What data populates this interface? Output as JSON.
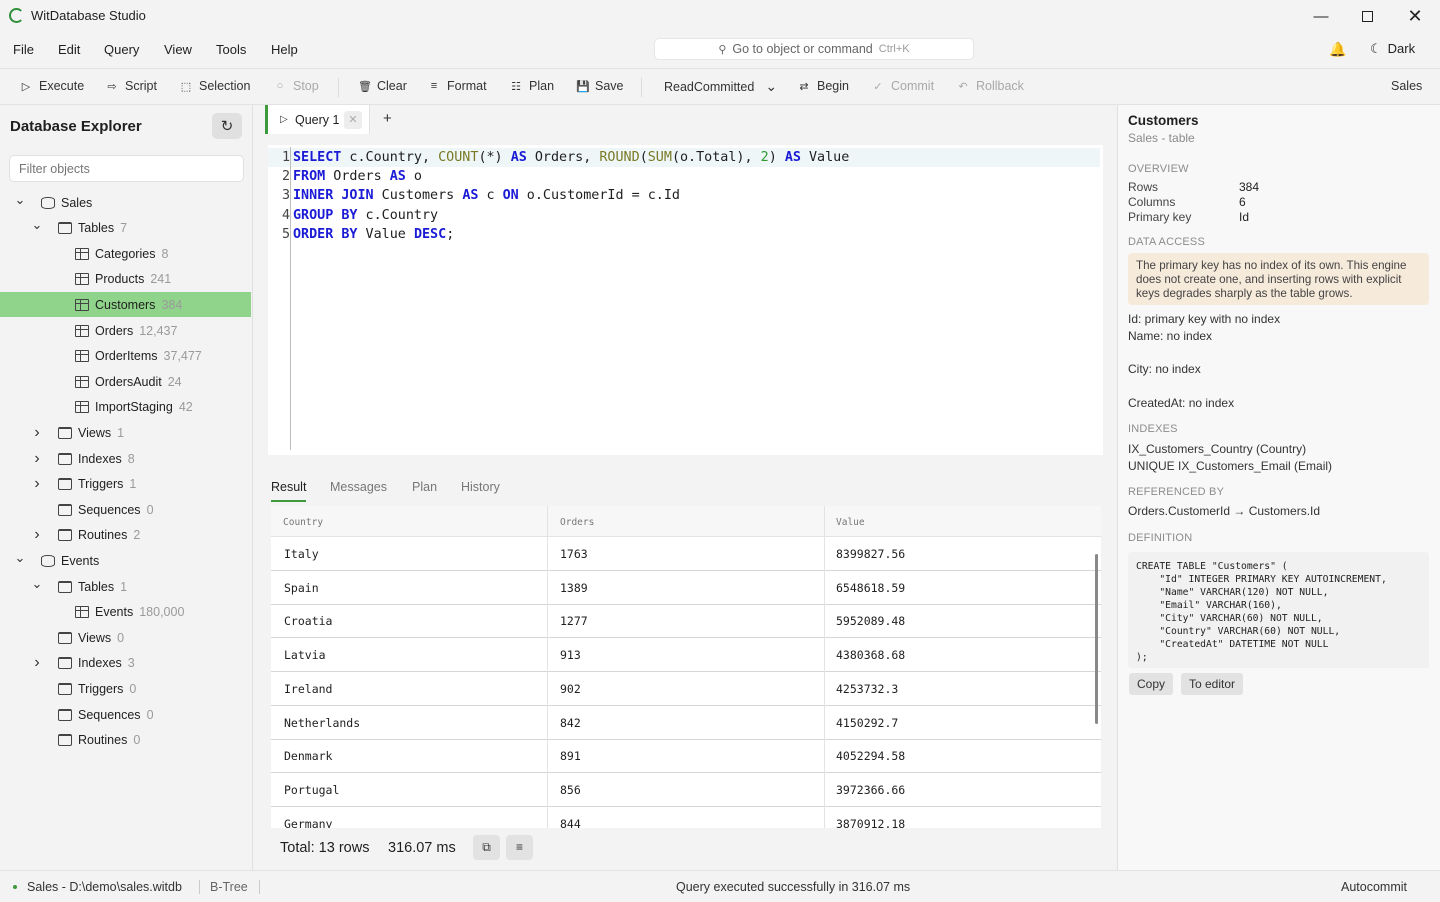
{
  "app": {
    "title": "WitDatabase Studio"
  },
  "menu": [
    "File",
    "Edit",
    "Query",
    "View",
    "Tools",
    "Help"
  ],
  "command_search": {
    "placeholder": "Go to object or command",
    "shortcut": "Ctrl+K"
  },
  "theme_toggle": "Dark",
  "toolbar": {
    "execute": "Execute",
    "script": "Script",
    "selection": "Selection",
    "stop": "Stop",
    "clear": "Clear",
    "format": "Format",
    "plan": "Plan",
    "save": "Save",
    "isolation": "ReadCommitted",
    "begin": "Begin",
    "commit": "Commit",
    "rollback": "Rollback",
    "database": "Sales"
  },
  "explorer": {
    "title": "Database Explorer",
    "filter_placeholder": "Filter objects",
    "tree": [
      {
        "label": "Sales",
        "count": "",
        "level": 0,
        "kind": "db",
        "chev": "open"
      },
      {
        "label": "Tables",
        "count": "7",
        "level": 1,
        "kind": "folder",
        "chev": "open"
      },
      {
        "label": "Categories",
        "count": "8",
        "level": 2,
        "kind": "table",
        "chev": ""
      },
      {
        "label": "Products",
        "count": "241",
        "level": 2,
        "kind": "table",
        "chev": ""
      },
      {
        "label": "Customers",
        "count": "384",
        "level": 2,
        "kind": "table",
        "chev": "",
        "selected": true
      },
      {
        "label": "Orders",
        "count": "12,437",
        "level": 2,
        "kind": "table",
        "chev": ""
      },
      {
        "label": "OrderItems",
        "count": "37,477",
        "level": 2,
        "kind": "table",
        "chev": ""
      },
      {
        "label": "OrdersAudit",
        "count": "24",
        "level": 2,
        "kind": "table",
        "chev": ""
      },
      {
        "label": "ImportStaging",
        "count": "42",
        "level": 2,
        "kind": "table",
        "chev": ""
      },
      {
        "label": "Views",
        "count": "1",
        "level": 1,
        "kind": "folder",
        "chev": "closed"
      },
      {
        "label": "Indexes",
        "count": "8",
        "level": 1,
        "kind": "folder",
        "chev": "closed"
      },
      {
        "label": "Triggers",
        "count": "1",
        "level": 1,
        "kind": "folder",
        "chev": "closed"
      },
      {
        "label": "Sequences",
        "count": "0",
        "level": 1,
        "kind": "folder",
        "chev": ""
      },
      {
        "label": "Routines",
        "count": "2",
        "level": 1,
        "kind": "folder",
        "chev": "closed"
      },
      {
        "label": "Events",
        "count": "",
        "level": 0,
        "kind": "db",
        "chev": "open"
      },
      {
        "label": "Tables",
        "count": "1",
        "level": 1,
        "kind": "folder",
        "chev": "open"
      },
      {
        "label": "Events",
        "count": "180,000",
        "level": 2,
        "kind": "table",
        "chev": ""
      },
      {
        "label": "Views",
        "count": "0",
        "level": 1,
        "kind": "folder",
        "chev": ""
      },
      {
        "label": "Indexes",
        "count": "3",
        "level": 1,
        "kind": "folder",
        "chev": "closed"
      },
      {
        "label": "Triggers",
        "count": "0",
        "level": 1,
        "kind": "folder",
        "chev": ""
      },
      {
        "label": "Sequences",
        "count": "0",
        "level": 1,
        "kind": "folder",
        "chev": ""
      },
      {
        "label": "Routines",
        "count": "0",
        "level": 1,
        "kind": "folder",
        "chev": ""
      }
    ]
  },
  "editor": {
    "tab_label": "Query 1",
    "lines": [
      [
        [
          "kw",
          "SELECT"
        ],
        [
          "tx",
          " c.Country, "
        ],
        [
          "fn",
          "COUNT"
        ],
        [
          "tx",
          "(*) "
        ],
        [
          "kw",
          "AS"
        ],
        [
          "tx",
          " Orders, "
        ],
        [
          "fn",
          "ROUND"
        ],
        [
          "tx",
          "("
        ],
        [
          "fn",
          "SUM"
        ],
        [
          "tx",
          "(o.Total), "
        ],
        [
          "nm",
          "2"
        ],
        [
          "tx",
          ") "
        ],
        [
          "kw",
          "AS"
        ],
        [
          "tx",
          " Value"
        ]
      ],
      [
        [
          "kw",
          "FROM"
        ],
        [
          "tx",
          " Orders "
        ],
        [
          "kw",
          "AS"
        ],
        [
          "tx",
          " o"
        ]
      ],
      [
        [
          "kw",
          "INNER JOIN"
        ],
        [
          "tx",
          " Customers "
        ],
        [
          "kw",
          "AS"
        ],
        [
          "tx",
          " c "
        ],
        [
          "kw",
          "ON"
        ],
        [
          "tx",
          " o.CustomerId = c.Id"
        ]
      ],
      [
        [
          "kw",
          "GROUP BY"
        ],
        [
          "tx",
          " c.Country"
        ]
      ],
      [
        [
          "kw",
          "ORDER BY"
        ],
        [
          "tx",
          " Value "
        ],
        [
          "kw",
          "DESC"
        ],
        [
          "tx",
          ";"
        ]
      ]
    ]
  },
  "results": {
    "tabs": [
      "Result",
      "Messages",
      "Plan",
      "History"
    ],
    "columns": [
      "Country",
      "Orders",
      "Value"
    ],
    "rows": [
      [
        "Italy",
        "1763",
        "8399827.56"
      ],
      [
        "Spain",
        "1389",
        "6548618.59"
      ],
      [
        "Croatia",
        "1277",
        "5952089.48"
      ],
      [
        "Latvia",
        "913",
        "4380368.68"
      ],
      [
        "Ireland",
        "902",
        "4253732.3"
      ],
      [
        "Netherlands",
        "842",
        "4150292.7"
      ],
      [
        "Denmark",
        "891",
        "4052294.58"
      ],
      [
        "Portugal",
        "856",
        "3972366.66"
      ],
      [
        "Germany",
        "844",
        "3870912.18"
      ]
    ],
    "total": "Total: 13 rows",
    "elapsed": "316.07 ms"
  },
  "details": {
    "title": "Customers",
    "subtitle": "Sales - table",
    "overview_label": "OVERVIEW",
    "overview": [
      [
        "Rows",
        "384"
      ],
      [
        "Columns",
        "6"
      ],
      [
        "Primary key",
        "Id"
      ]
    ],
    "data_access_label": "DATA ACCESS",
    "warning": "The primary key has no index of its own. This engine does not create one, and inserting rows with explicit keys degrades sharply as the table grows.",
    "access_lines": [
      "Id: primary key with no index",
      "Name: no index",
      "City: no index",
      "CreatedAt: no index"
    ],
    "indexes_label": "INDEXES",
    "indexes": [
      "IX_Customers_Country (Country)",
      "UNIQUE IX_Customers_Email (Email)"
    ],
    "referenced_label": "REFERENCED BY",
    "referenced": "Orders.CustomerId → Customers.Id",
    "definition_label": "DEFINITION",
    "definition": "CREATE TABLE \"Customers\" (\n    \"Id\" INTEGER PRIMARY KEY AUTOINCREMENT,\n    \"Name\" VARCHAR(120) NOT NULL,\n    \"Email\" VARCHAR(160),\n    \"City\" VARCHAR(60) NOT NULL,\n    \"Country\" VARCHAR(60) NOT NULL,\n    \"CreatedAt\" DATETIME NOT NULL\n);",
    "copy": "Copy",
    "to_editor": "To editor"
  },
  "status": {
    "connection": "Sales - D:\\demo\\sales.witdb",
    "engine": "B-Tree",
    "message": "Query executed successfully in 316.07 ms",
    "mode": "Autocommit"
  },
  "colors": {
    "accent": "#3c9a3c",
    "selection": "#8fd48a",
    "keyword": "#1b1bd6",
    "function": "#7a7a25",
    "number": "#2f9a2f",
    "warning_bg": "#f6eadb"
  }
}
